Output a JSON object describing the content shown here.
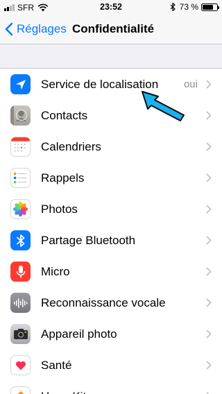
{
  "status_bar": {
    "carrier": "SFR",
    "time": "23:52",
    "battery_percent": "73 %",
    "battery_level": 0.73
  },
  "nav_bar": {
    "back_label": "Réglages",
    "title": "Confidentialité"
  },
  "settings_list": {
    "items": [
      {
        "label": "Service de localisation",
        "value": "oui",
        "icon": "location-arrow-icon",
        "icon_color": "#0a7afe"
      },
      {
        "label": "Contacts",
        "icon": "contacts-icon",
        "icon_color": "#b0aba6"
      },
      {
        "label": "Calendriers",
        "icon": "calendar-icon",
        "icon_color": "#ffffff"
      },
      {
        "label": "Rappels",
        "icon": "reminders-icon",
        "icon_color": "#ffffff"
      },
      {
        "label": "Photos",
        "icon": "photos-icon",
        "icon_color": "#ffffff"
      },
      {
        "label": "Partage Bluetooth",
        "icon": "bluetooth-icon",
        "icon_color": "#0a7afe"
      },
      {
        "label": "Micro",
        "icon": "microphone-icon",
        "icon_color": "#fd3a30"
      },
      {
        "label": "Reconnaissance vocale",
        "icon": "speech-recognition-icon",
        "icon_color": "#8e8e93"
      },
      {
        "label": "Appareil photo",
        "icon": "camera-icon",
        "icon_color": "#8e8e93"
      },
      {
        "label": "Santé",
        "icon": "health-heart-icon",
        "icon_color": "#ffffff"
      },
      {
        "label": "HomeKit",
        "icon": "homekit-icon",
        "icon_color": "#ff9500"
      }
    ]
  },
  "colors": {
    "accent": "#0a7afe",
    "annotation_arrow": "#1ab0f0",
    "background": "#efeff4"
  }
}
